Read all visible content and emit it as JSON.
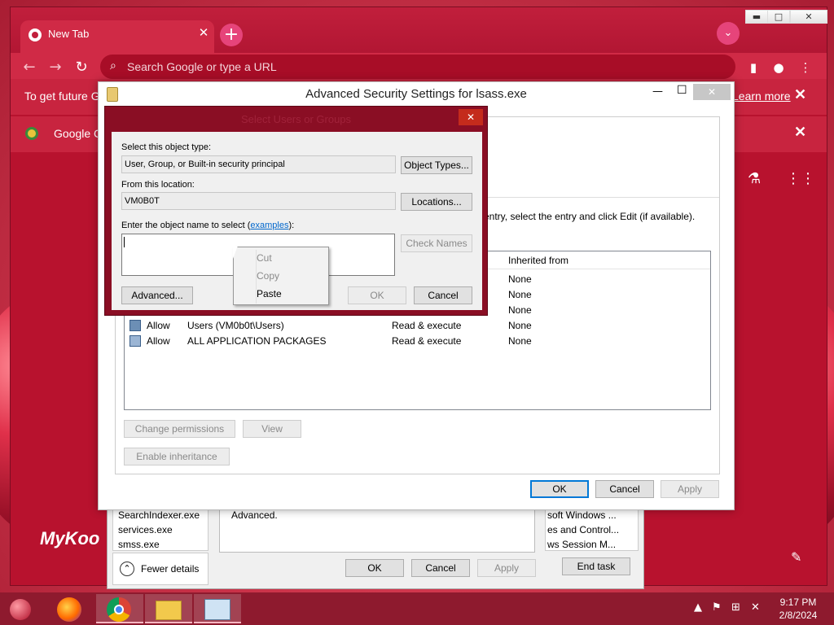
{
  "browser": {
    "tab_title": "New Tab",
    "tab_close": "✕",
    "new_tab": "+",
    "omnibox_placeholder": "Search Google or type a URL",
    "infobar1_text": "To get future Go",
    "infobar1_link": "Learn more",
    "infobar2_text": "Google Cl",
    "ntp_brand": "MyKoo",
    "colors": {
      "frame": "#b8122e",
      "toolbar": "#d02a46"
    }
  },
  "advsec": {
    "title": "Advanced Security Settings for lsass.exe",
    "instruction": "entry, select the entry and click Edit (if available).",
    "column_inherited": "Inherited from",
    "rows": [
      {
        "type": "",
        "principal": "",
        "access": "",
        "inherited": "None"
      },
      {
        "type": "",
        "principal": "",
        "access": "",
        "inherited": "None"
      },
      {
        "type": "",
        "principal": "",
        "access": "",
        "inherited": "None"
      },
      {
        "type": "Allow",
        "principal": "Users (VM0b0t\\Users)",
        "access": "Read & execute",
        "inherited": "None"
      },
      {
        "type": "Allow",
        "principal": "ALL APPLICATION PACKAGES",
        "access": "Read & execute",
        "inherited": "None"
      }
    ],
    "change_permissions": "Change permissions",
    "view": "View",
    "enable_inheritance": "Enable inheritance",
    "ok": "OK",
    "cancel": "Cancel",
    "apply": "Apply"
  },
  "select_dialog": {
    "title": "Select Users or Groups",
    "close": "✕",
    "object_type_label": "Select this object type:",
    "object_type_value": "User, Group, or Built-in security principal",
    "object_types_button": "Object Types...",
    "location_label": "From this location:",
    "location_value": "VM0B0T",
    "locations_button": "Locations...",
    "enter_label_pre": "Enter the object name to select (",
    "enter_label_link": "examples",
    "enter_label_post": "):",
    "object_name_value": "",
    "check_names": "Check Names",
    "advanced": "Advanced...",
    "ok": "OK",
    "cancel": "Cancel"
  },
  "context_menu": {
    "cut": "Cut",
    "copy": "Copy",
    "paste": "Paste"
  },
  "taskmgr": {
    "processes": [
      "SearchIndexer.exe",
      "services.exe",
      "smss.exe"
    ],
    "fewer_details": "Fewer details",
    "advanced_text": "Advanced.",
    "services_col": [
      "soft Windows ...",
      "es and Control...",
      "ws Session M..."
    ],
    "ok": "OK",
    "cancel": "Cancel",
    "apply": "Apply",
    "end_task": "End task"
  },
  "taskbar": {
    "time": "9:17 PM",
    "date": "2/8/2024"
  }
}
